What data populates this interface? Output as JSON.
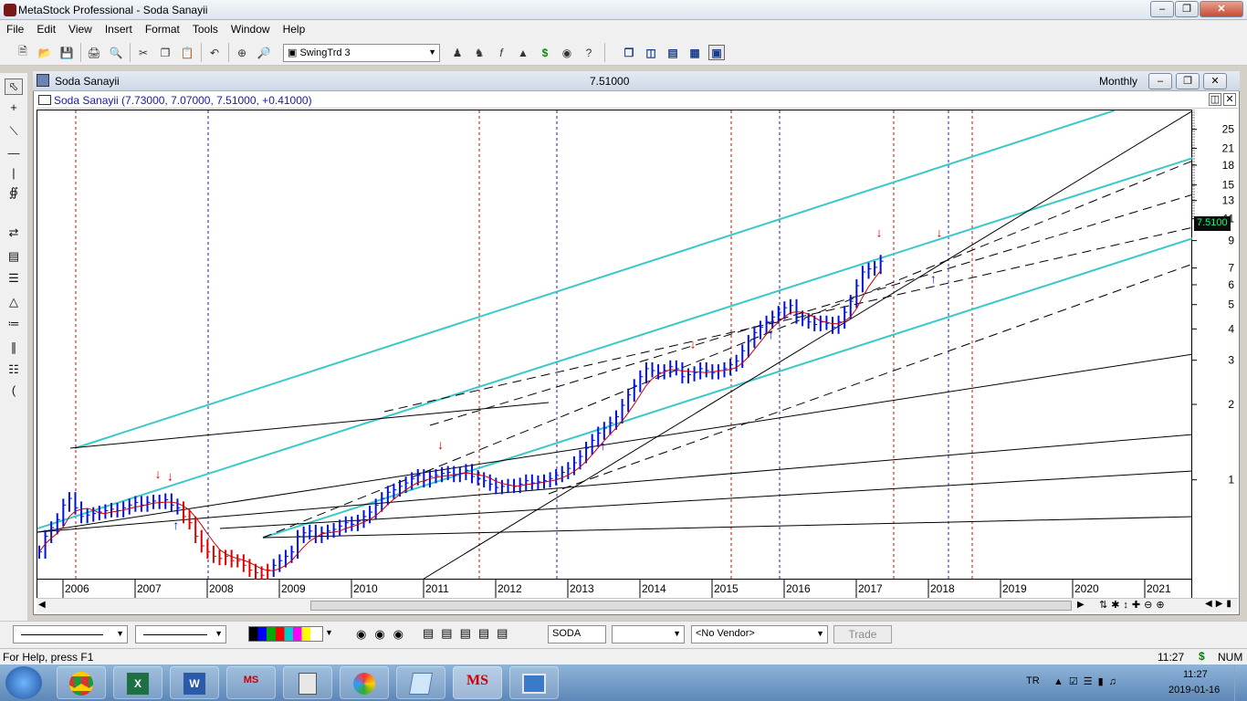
{
  "window": {
    "title": "MetaStock Professional - Soda Sanayii"
  },
  "menu": [
    "File",
    "Edit",
    "View",
    "Insert",
    "Format",
    "Tools",
    "Window",
    "Help"
  ],
  "toolbar": {
    "template": "SwingTrd 3"
  },
  "chart_window": {
    "title": "Soda Sanayii",
    "price": "7.51000",
    "periodicity": "Monthly",
    "security_line": "Soda Sanayii (7.73000, 7.07000, 7.51000, +0.41000)",
    "last_price_tag": "7.5100"
  },
  "bottom": {
    "symbol": "SODA",
    "vendor": "<No Vendor>",
    "trade_button": "Trade"
  },
  "status": {
    "help": "For Help, press F1",
    "time": "11:27",
    "num": "NUM"
  },
  "tray": {
    "lang": "TR",
    "time": "11:27",
    "date": "2019-01-16"
  },
  "chart_data": {
    "type": "bar",
    "scale": "log",
    "x_labels": [
      "2006",
      "2007",
      "2008",
      "2009",
      "2010",
      "2011",
      "2012",
      "2013",
      "2014",
      "2015",
      "2016",
      "2017",
      "2018",
      "2019",
      "2020",
      "2021"
    ],
    "y_tick_labels": [
      "25",
      "21",
      "18",
      "15",
      "13",
      "11",
      "9",
      "7",
      "6",
      "5",
      "4",
      "3",
      "2",
      "1"
    ],
    "ylim": [
      0.4,
      30
    ],
    "monthly_close": [
      0.52,
      0.6,
      0.65,
      0.7,
      0.8,
      0.85,
      0.78,
      0.72,
      0.73,
      0.74,
      0.75,
      0.76,
      0.77,
      0.76,
      0.78,
      0.8,
      0.82,
      0.8,
      0.82,
      0.83,
      0.82,
      0.84,
      0.8,
      0.78,
      0.72,
      0.68,
      0.6,
      0.55,
      0.52,
      0.5,
      0.49,
      0.5,
      0.48,
      0.48,
      0.46,
      0.44,
      0.43,
      0.42,
      0.44,
      0.46,
      0.48,
      0.5,
      0.52,
      0.6,
      0.62,
      0.63,
      0.6,
      0.62,
      0.63,
      0.64,
      0.66,
      0.68,
      0.67,
      0.69,
      0.72,
      0.75,
      0.8,
      0.85,
      0.9,
      0.92,
      0.95,
      0.98,
      1.02,
      1.05,
      1.0,
      1.04,
      1.05,
      1.07,
      1.08,
      1.05,
      1.07,
      1.1,
      1.04,
      1.02,
      1.0,
      0.97,
      0.94,
      0.95,
      0.96,
      0.95,
      0.97,
      1.0,
      0.98,
      0.99,
      1.0,
      1.02,
      1.05,
      1.08,
      1.12,
      1.18,
      1.25,
      1.35,
      1.45,
      1.55,
      1.62,
      1.7,
      1.8,
      2.0,
      2.2,
      2.4,
      2.6,
      2.8,
      2.75,
      2.7,
      2.75,
      2.85,
      2.8,
      2.6,
      2.65,
      2.7,
      2.8,
      2.75,
      2.7,
      2.75,
      2.8,
      2.9,
      3.0,
      3.3,
      3.6,
      3.9,
      4.1,
      4.3,
      4.5,
      4.7,
      4.9,
      5.0,
      4.5,
      4.4,
      4.3,
      4.2,
      4.3,
      4.25,
      4.1,
      4.3,
      4.7,
      5.2,
      6.0,
      6.8,
      7.0,
      7.1,
      7.51
    ],
    "volume_area": false,
    "sell_arrows": [
      "2007",
      "2007",
      "2011",
      "2015",
      "2017",
      "2018"
    ],
    "buy_arrows": [
      "2007",
      "2009",
      "2013",
      "2016",
      "2018"
    ]
  }
}
